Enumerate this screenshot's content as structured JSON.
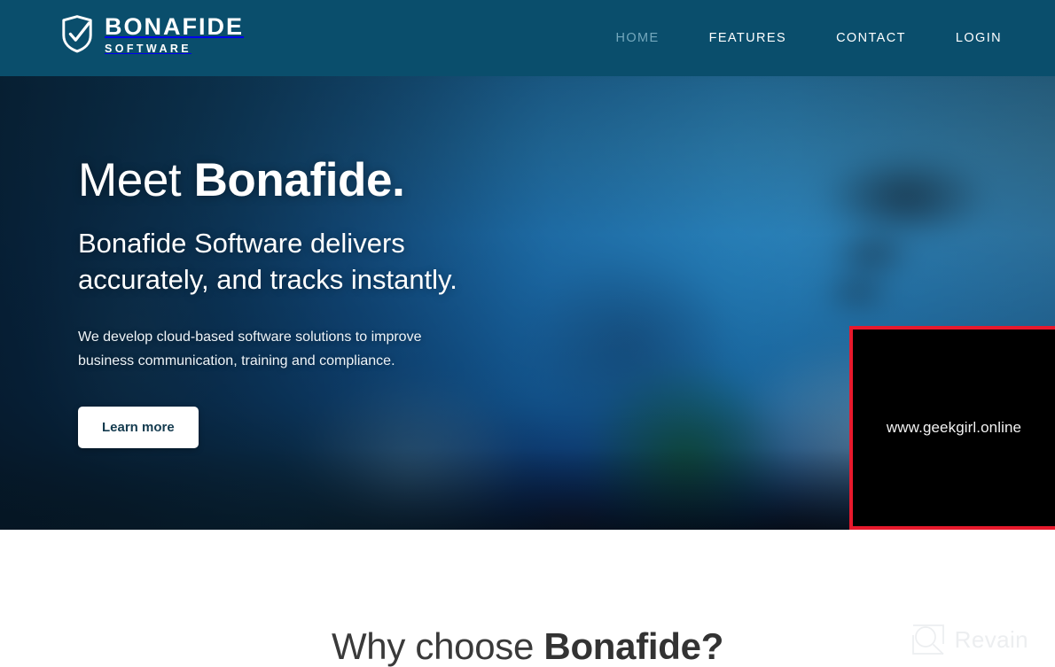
{
  "header": {
    "logo": {
      "icon": "shield-check-icon",
      "main": "BONAFIDE",
      "sub": "SOFTWARE"
    },
    "nav": [
      {
        "label": "HOME",
        "active": true
      },
      {
        "label": "FEATURES",
        "active": false
      },
      {
        "label": "CONTACT",
        "active": false
      },
      {
        "label": "LOGIN",
        "active": false
      }
    ],
    "bg_color": "#0a4e6c"
  },
  "hero": {
    "title_light": "Meet ",
    "title_bold": "Bonafide.",
    "subtitle_line1": "Bonafide Software delivers",
    "subtitle_line2": "accurately, and tracks instantly.",
    "description_line1": "We develop cloud-based software solutions to improve",
    "description_line2": "business communication, training and compliance.",
    "cta_label": "Learn more",
    "cta_bg": "#ffffff",
    "cta_text_color": "#143b4f"
  },
  "overlay": {
    "url_text": "www.geekgirl.online",
    "border_color": "#e8192c",
    "bg_color": "#000000",
    "text_color": "#f2f2f2"
  },
  "section": {
    "title_light": "Why choose ",
    "title_bold": "Bonafide?"
  },
  "watermark": {
    "icon": "revain-magnifier-icon",
    "label": "Revain"
  }
}
